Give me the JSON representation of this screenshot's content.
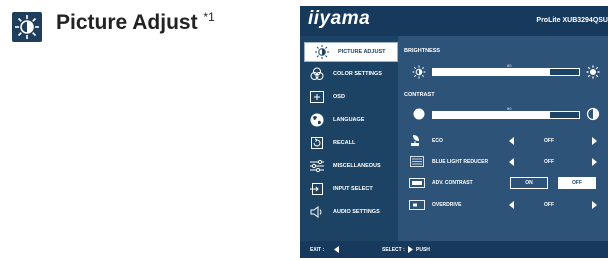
{
  "heading": {
    "title": "Picture Adjust",
    "sup_prefix": "*",
    "sup_num": "1"
  },
  "osd": {
    "brand": "iiyama",
    "model": "ProLite XUB3294QSU",
    "menu": [
      {
        "label": "PICTURE ADJUST",
        "icon": "picture-adjust-icon",
        "active": true
      },
      {
        "label": "COLOR SETTINGS",
        "icon": "color-settings-icon",
        "active": false
      },
      {
        "label": "OSD",
        "icon": "osd-icon",
        "active": false
      },
      {
        "label": "LANGUAGE",
        "icon": "language-globe-icon",
        "active": false
      },
      {
        "label": "RECALL",
        "icon": "recall-icon",
        "active": false
      },
      {
        "label": "MISCELLANEOUS",
        "icon": "miscellaneous-icon",
        "active": false
      },
      {
        "label": "INPUT SELECT",
        "icon": "input-select-icon",
        "active": false
      },
      {
        "label": "AUDIO SETTINGS",
        "icon": "audio-settings-icon",
        "active": false
      }
    ],
    "brightness": {
      "label": "BRIGHTNESS",
      "value": "80",
      "level": 0.8
    },
    "contrast": {
      "label": "CONTRAST",
      "value": "80",
      "level": 0.8
    },
    "options": [
      {
        "label": "ECO",
        "value": "OFF",
        "type": "arrows",
        "icon": "eco-icon"
      },
      {
        "label": "BLUE LIGHT REDUCER",
        "value": "OFF",
        "type": "arrows",
        "icon": "blue-light-reducer-icon"
      },
      {
        "label": "ADV. CONTRAST",
        "on": "ON",
        "off": "OFF",
        "selected": "OFF",
        "type": "toggle",
        "icon": "adv-contrast-icon"
      },
      {
        "label": "OVERDRIVE",
        "value": "OFF",
        "type": "arrows",
        "icon": "overdrive-icon"
      }
    ],
    "footer": {
      "exit": "EXIT :",
      "select": "SELECT :",
      "push": "PUSH"
    }
  },
  "colors": {
    "osd_bg": "#2d5478",
    "osd_dark": "#173a5c",
    "menu_bg": "#1c4264",
    "active_bg": "#ffffff"
  }
}
